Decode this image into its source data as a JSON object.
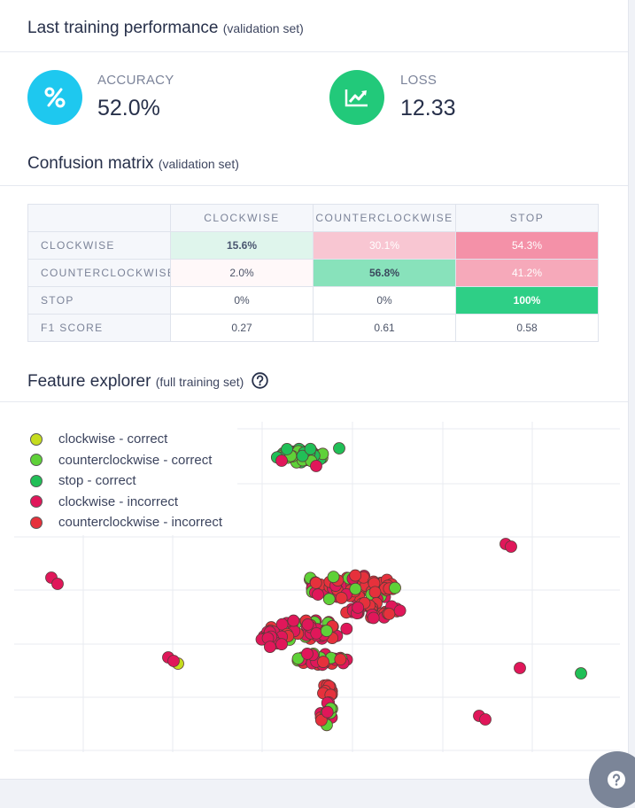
{
  "performance": {
    "title": "Last training performance",
    "subtitle": "(validation set)",
    "accuracy": {
      "label": "ACCURACY",
      "value": "52.0%",
      "icon": "percent-icon",
      "color": "#1ec8ef"
    },
    "loss": {
      "label": "LOSS",
      "value": "12.33",
      "icon": "chart-line-icon",
      "color": "#22c97a"
    }
  },
  "confusion": {
    "title": "Confusion matrix",
    "subtitle": "(validation set)",
    "columns": [
      "CLOCKWISE",
      "COUNTERCLOCKWISE",
      "STOP"
    ],
    "rows": [
      {
        "label": "CLOCKWISE",
        "cells": [
          "15.6%",
          "30.1%",
          "54.3%"
        ]
      },
      {
        "label": "COUNTERCLOCKWISE",
        "cells": [
          "2.0%",
          "56.8%",
          "41.2%"
        ]
      },
      {
        "label": "STOP",
        "cells": [
          "0%",
          "0%",
          "100%"
        ]
      },
      {
        "label": "F1 SCORE",
        "cells": [
          "0.27",
          "0.61",
          "0.58"
        ]
      }
    ]
  },
  "features": {
    "title": "Feature explorer",
    "subtitle": "(full training set)",
    "legend": [
      {
        "label": "clockwise - correct",
        "color": "#c5dc1e"
      },
      {
        "label": "counterclockwise - correct",
        "color": "#5fd138"
      },
      {
        "label": "stop - correct",
        "color": "#21bf57"
      },
      {
        "label": "clockwise - incorrect",
        "color": "#e0175a"
      },
      {
        "label": "counterclockwise - incorrect",
        "color": "#e6313c"
      }
    ]
  }
}
